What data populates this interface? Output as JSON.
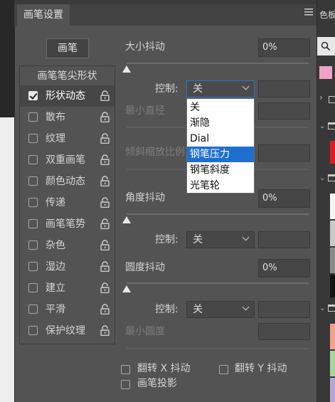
{
  "panel": {
    "title": "画笔设置",
    "brush_button": "画笔",
    "list_header": "画笔笔尖形状",
    "items": [
      {
        "label": "形状动态",
        "checked": true,
        "selected": true
      },
      {
        "label": "散布",
        "checked": false
      },
      {
        "label": "纹理",
        "checked": false
      },
      {
        "label": "双重画笔",
        "checked": false
      },
      {
        "label": "颜色动态",
        "checked": false
      },
      {
        "label": "传递",
        "checked": false
      },
      {
        "label": "画笔笔势",
        "checked": false
      },
      {
        "label": "杂色",
        "checked": false
      },
      {
        "label": "湿边",
        "checked": false
      },
      {
        "label": "建立",
        "checked": false
      },
      {
        "label": "平滑",
        "checked": false
      },
      {
        "label": "保护纹理",
        "checked": false
      }
    ]
  },
  "settings": {
    "size_jitter_label": "大小抖动",
    "size_jitter_value": "0%",
    "control_label": "控制:",
    "control1_value": "关",
    "min_diameter_label": "最小直径",
    "tilt_scale_label": "倾斜缩放比例",
    "angle_jitter_label": "角度抖动",
    "angle_jitter_value": "0%",
    "control2_value": "关",
    "roundness_jitter_label": "圆度抖动",
    "roundness_jitter_value": "0%",
    "control3_value": "关",
    "min_roundness_label": "最小圆度",
    "flip_x_label": "翻转 X 抖动",
    "flip_y_label": "翻转 Y 抖动",
    "brush_projection_label": "画笔投影"
  },
  "dropdown": {
    "options": [
      "关",
      "渐隐",
      "Dial",
      "钢笔压力",
      "钢笔斜度",
      "光笔轮"
    ],
    "highlighted_index": 3
  },
  "right_panel": {
    "title_fragment": "色板"
  },
  "colors": {
    "highlight": "#1e6fd0",
    "panel_bg": "#535353"
  }
}
